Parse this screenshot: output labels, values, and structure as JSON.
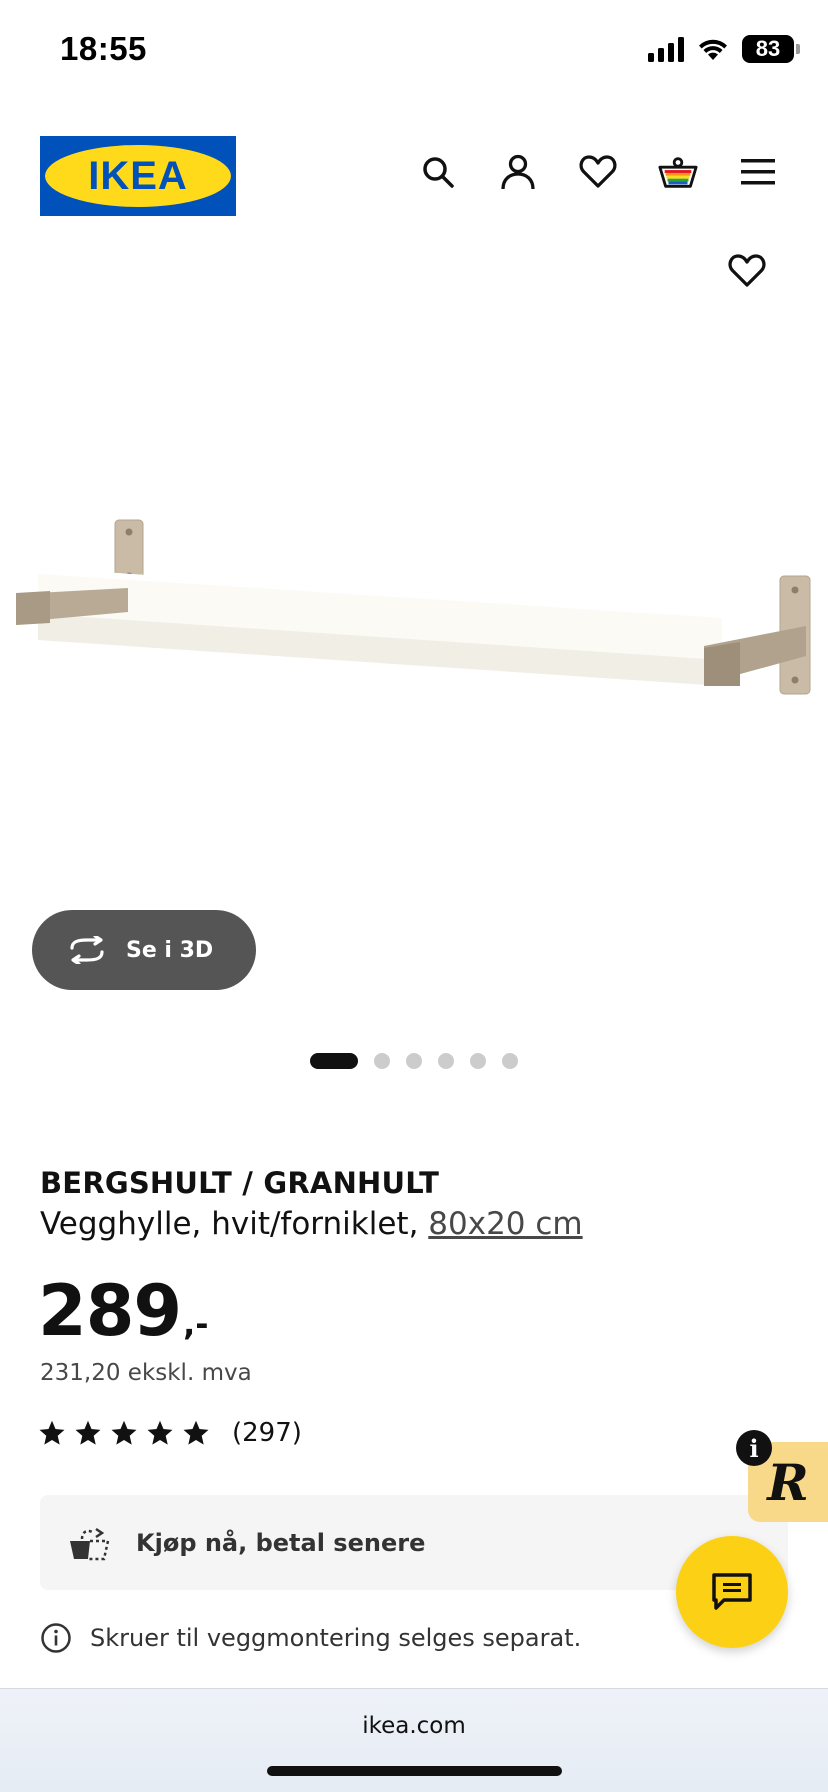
{
  "status_bar": {
    "time": "18:55",
    "battery": "83"
  },
  "header": {
    "logo_text": "IKEA",
    "icons": [
      "search-icon",
      "profile-icon",
      "favorites-icon",
      "cart-icon",
      "menu-icon"
    ]
  },
  "product": {
    "name": "BERGSHULT / GRANHULT",
    "description": "Vegghylle, hvit/forniklet,",
    "size": "80x20 cm",
    "price_integer": "289",
    "price_suffix": ",-",
    "price_excl_vat": "231,20 ekskl. mva",
    "rating": 5,
    "rating_count": "(297)",
    "image_count": 6,
    "active_image": 1
  },
  "buttons": {
    "view_3d": "Se i 3D",
    "pay_later": "Kjøp nå, betal senere"
  },
  "notes": {
    "screws": "Skruer til veggmontering selges separat."
  },
  "badges": {
    "info": "i",
    "r_logo": "R"
  },
  "browser": {
    "url": "ikea.com"
  },
  "colors": {
    "ikea_blue": "#0051ba",
    "ikea_yellow": "#ffda1a",
    "chat_yellow": "#fcd115",
    "button_gray": "#555555"
  }
}
